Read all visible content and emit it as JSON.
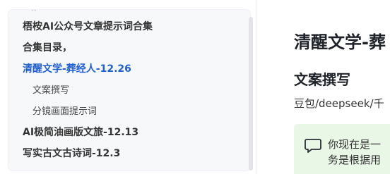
{
  "toc": {
    "items": [
      {
        "label": "梧桉AI公众号文章提示词合集",
        "style": "bold"
      },
      {
        "label": "合集目录，",
        "style": "bold"
      },
      {
        "label": "清醒文学-葬经人-12.26",
        "style": "active"
      },
      {
        "label": "文案撰写",
        "style": "sub"
      },
      {
        "label": "分镜画面提示词",
        "style": "sub"
      },
      {
        "label": "AI极简油画版文旅-12.13",
        "style": "bold"
      },
      {
        "label": "写实古文古诗词-12.3",
        "style": "bold"
      }
    ]
  },
  "content": {
    "title": "清醒文学-葬",
    "subtitle": "文案撰写",
    "meta": "豆包/deepseek/千",
    "prompt_box": {
      "icon": "chat-bubble-icon",
      "line1": "你现在是一",
      "line2": "务是根据用"
    }
  },
  "colors": {
    "active": "#1f5fd1",
    "prompt_bg": "#e9f7e6",
    "sidebar_bg": "#f7f8fa"
  }
}
